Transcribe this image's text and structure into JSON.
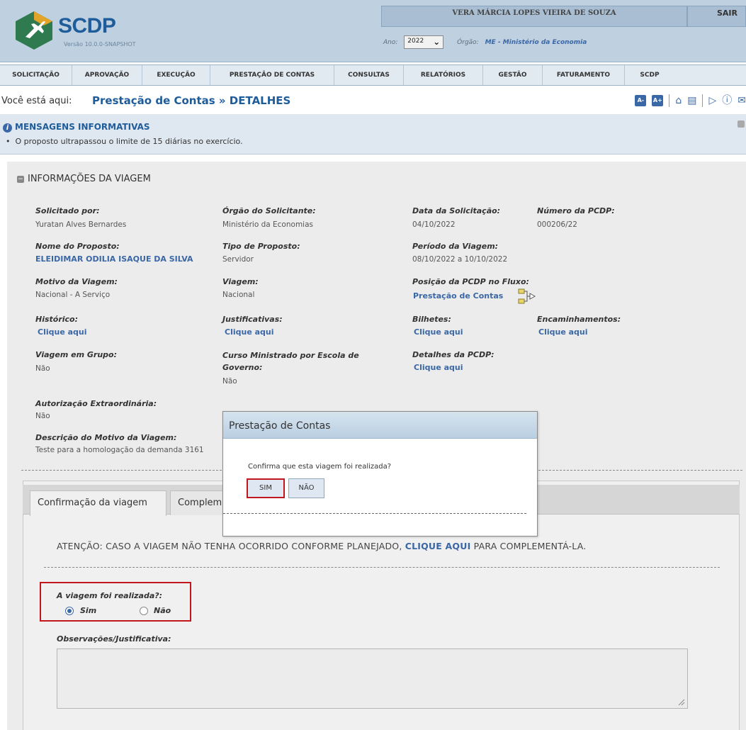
{
  "header": {
    "brand": "SCDP",
    "version": "Versão 10.0.0-SNAPSHOT",
    "user_name": "VERA MÁRCIA LOPES VIEIRA DE SOUZA",
    "logout_label": "SAIR",
    "year_label": "Ano:",
    "year_value": "2022",
    "orgao_label": "Órgão:",
    "orgao_value": "ME - Ministério da Economia"
  },
  "menu": [
    "SOLICITAÇÃO",
    "APROVAÇÃO",
    "EXECUÇÃO",
    "PRESTAÇÃO DE CONTAS",
    "CONSULTAS",
    "RELATÓRIOS",
    "GESTÃO",
    "FATURAMENTO",
    "SCDP"
  ],
  "breadcrumb": {
    "here_label": "Você está aqui:",
    "path": "Prestação de Contas » DETALHES"
  },
  "toolbar": {
    "font_decrease": "A-",
    "font_increase": "A+"
  },
  "messages": {
    "title": "MENSAGENS INFORMATIVAS",
    "items": [
      "O proposto ultrapassou o limite de 15 diárias no exercício."
    ]
  },
  "section": {
    "title": "INFORMAÇÕES DA VIAGEM"
  },
  "fields": {
    "solicitado_por_label": "Solicitado por:",
    "solicitado_por_value": "Yuratan Alves Bernardes",
    "orgao_solicitante_label": "Órgão do Solicitante:",
    "orgao_solicitante_value": "Ministério da Economias",
    "data_solicitacao_label": "Data da Solicitação:",
    "data_solicitacao_value": "04/10/2022",
    "numero_pcdp_label": "Número da PCDP:",
    "numero_pcdp_value": "000206/22",
    "nome_proposto_label": "Nome do Proposto:",
    "nome_proposto_value": "ELEIDIMAR ODILIA ISAQUE DA SILVA",
    "tipo_proposto_label": "Tipo de Proposto:",
    "tipo_proposto_value": "Servidor",
    "periodo_label": "Período da Viagem:",
    "periodo_value": "08/10/2022 a 10/10/2022",
    "motivo_label": "Motivo da Viagem:",
    "motivo_value": "Nacional - A Serviço",
    "viagem_label": "Viagem:",
    "viagem_value": "Nacional",
    "posicao_label": "Posição da PCDP no Fluxo:",
    "posicao_value": "Prestação de Contas",
    "historico_label": "Histórico:",
    "justificativas_label": "Justificativas:",
    "bilhetes_label": "Bilhetes:",
    "encaminhamentos_label": "Encaminhamentos:",
    "clique_aqui": "Clique aqui",
    "grupo_label": "Viagem em Grupo:",
    "grupo_value": "Não",
    "curso_label_1": "Curso Ministrado por Escola de",
    "curso_label_2": "Governo:",
    "curso_value": "Não",
    "detalhes_label": "Detalhes da PCDP:",
    "autorizacao_label": "Autorização Extraordinária:",
    "autorizacao_value": "Não",
    "descricao_label": "Descrição do Motivo da Viagem:",
    "descricao_value": "Teste para a homologação da demanda 3161"
  },
  "tabs": {
    "confirmacao": "Confirmação da viagem",
    "complemento": "Complem"
  },
  "attention": {
    "before": "ATENÇÃO: CASO A VIAGEM NÃO TENHA OCORRIDO CONFORME PLANEJADO, ",
    "link": "CLIQUE AQUI",
    "after": " PARA COMPLEMENTÁ-LA."
  },
  "realizada": {
    "label": "A viagem foi realizada?:",
    "sim": "Sim",
    "nao": "Não",
    "selected": "Sim"
  },
  "observacoes": {
    "label": "Observações/Justificativa:",
    "value": ""
  },
  "dialog": {
    "title": "Prestação de Contas",
    "question": "Confirma que esta viagem foi realizada?",
    "yes": "SIM",
    "no": "NÃO"
  },
  "colors": {
    "brand_blue": "#1f5c9a",
    "link_blue": "#3a67a6",
    "highlight_red": "#c0161c"
  }
}
